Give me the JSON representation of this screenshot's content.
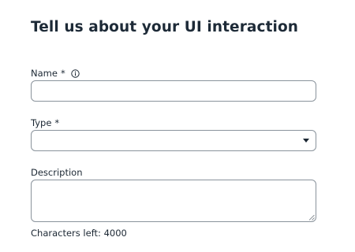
{
  "form": {
    "title": "Tell us about your UI interaction",
    "name": {
      "label": "Name",
      "required_mark": "*",
      "icon": "info-icon",
      "value": ""
    },
    "type": {
      "label": "Type",
      "required_mark": "*",
      "selected": "",
      "icon": "caret-down-icon"
    },
    "description": {
      "label": "Description",
      "value": ""
    },
    "characters_left": "Characters left: 4000"
  }
}
